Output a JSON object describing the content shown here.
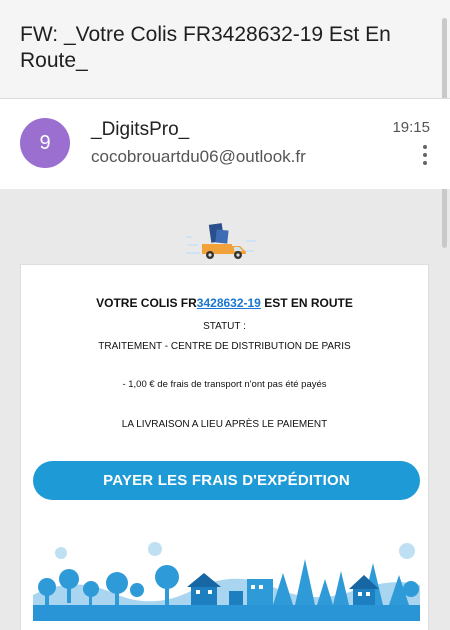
{
  "email": {
    "subject": "FW: _Votre Colis FR3428632-19 Est En Route_",
    "sender": {
      "avatar_letter": "9",
      "avatar_color": "#9a6fd0",
      "name": "_DigitsPro_",
      "address": "cocobrouartdu06@outlook.fr"
    },
    "time": "19:15"
  },
  "message": {
    "title_prefix": "VOTRE COLIS FR",
    "tracking_number": "3428632-19",
    "title_suffix": " EST EN ROUTE",
    "statut_label": "STATUT :",
    "statut_value": "TRAITEMENT - CENTRE DE DISTRIBUTION DE PARIS",
    "frais_notice": "- 1,00 € de frais de transport n'ont pas été payés",
    "livraison_notice": "LA LIVRAISON A LIEU APRÈS LE PAIEMENT",
    "pay_button": "PAYER LES FRAIS D'EXPÉDITION"
  },
  "colors": {
    "accent": "#1e9ad6",
    "link": "#1976d2",
    "truck": "#f2a23a"
  },
  "icons": {
    "truck": "delivery-truck-icon",
    "more": "more-vert-icon"
  }
}
